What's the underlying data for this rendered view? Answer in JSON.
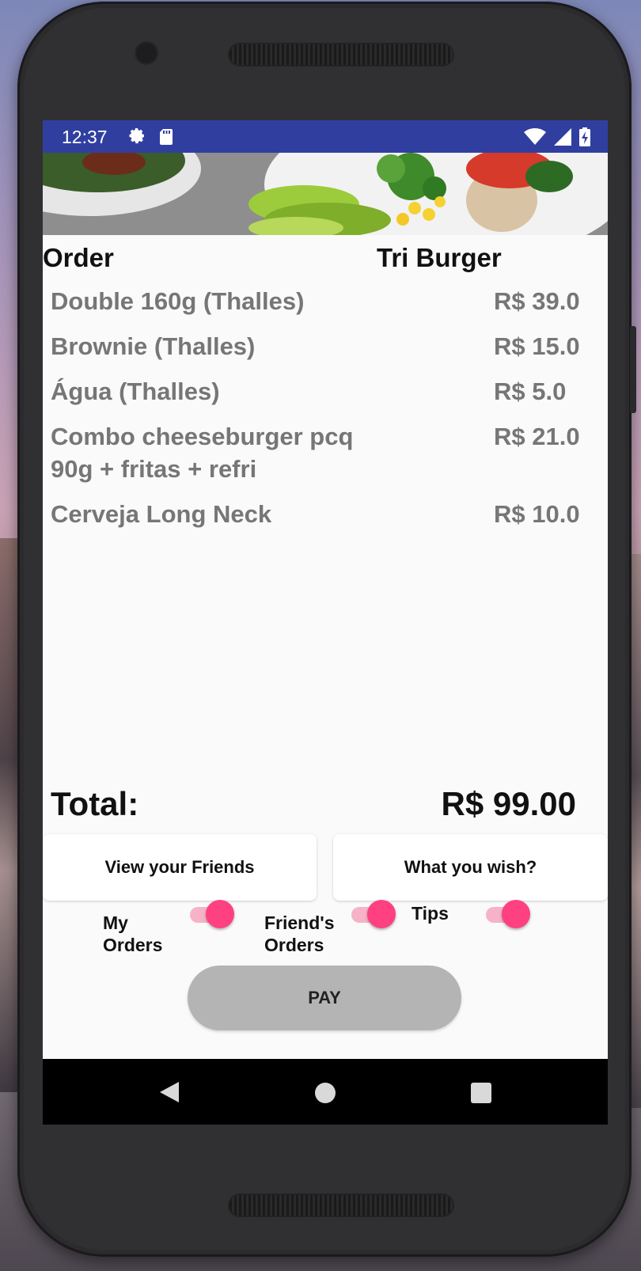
{
  "status_bar": {
    "time": "12:37",
    "icons_left": [
      "gear-icon",
      "sd-card-icon"
    ],
    "icons_right": [
      "wifi-icon",
      "signal-icon",
      "battery-charging-icon"
    ]
  },
  "header": {
    "order_label": "Order",
    "restaurant": "Tri Burger"
  },
  "items": [
    {
      "name": "Double 160g (Thalles)",
      "price": "R$ 39.0"
    },
    {
      "name": "Brownie (Thalles)",
      "price": "R$ 15.0"
    },
    {
      "name": "Água (Thalles)",
      "price": "R$ 5.0"
    },
    {
      "name": "Combo cheeseburger pcq 90g + fritas + refri",
      "price": "R$ 21.0"
    },
    {
      "name": "Cerveja Long Neck",
      "price": "R$ 10.0"
    }
  ],
  "total": {
    "label": "Total:",
    "value": "R$ 99.00"
  },
  "buttons": {
    "friends": "View your Friends",
    "wish": "What you wish?",
    "pay": "PAY"
  },
  "toggles": [
    {
      "label_line1": "My",
      "label_line2": "Orders",
      "on": true
    },
    {
      "label_line1": "Friend's",
      "label_line2": "Orders",
      "on": true
    },
    {
      "label_line1": "Tips",
      "label_line2": "",
      "on": true
    }
  ],
  "colors": {
    "status_bar": "#303f9f",
    "accent": "#ff4081",
    "pay_button": "#b4b4b4",
    "item_text": "#767676"
  }
}
